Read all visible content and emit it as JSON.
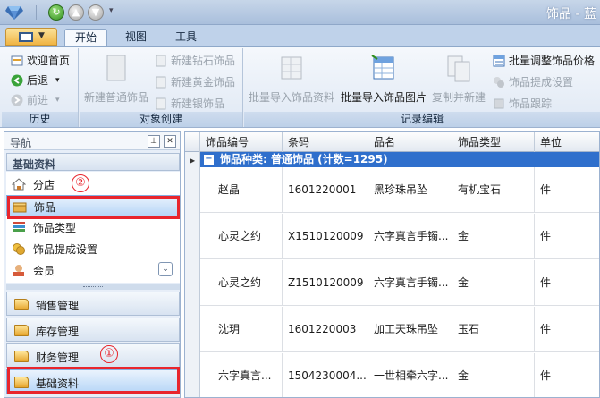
{
  "window": {
    "title": "饰品 - 蓝"
  },
  "ribbon_tabs": [
    {
      "label": "开始",
      "active": true
    },
    {
      "label": "视图",
      "active": false
    },
    {
      "label": "工具",
      "active": false
    }
  ],
  "groups": {
    "history": {
      "label": "历史",
      "home": "欢迎首页",
      "back": "后退",
      "forward": "前进"
    },
    "create": {
      "label": "对象创建",
      "new_normal": "新建普通饰品",
      "new_diamond": "新建钻石饰品",
      "new_gold": "新建黄金饰品",
      "new_silver": "新建银饰品"
    },
    "edit": {
      "label": "记录编辑",
      "batch_import_data": "批量导入饰品资料",
      "batch_import_images": "批量导入饰品图片",
      "copy_new": "复制并新建",
      "batch_adjust_price": "批量调整饰品价格",
      "commission": "饰品提成设置",
      "trace": "饰品跟踪"
    }
  },
  "nav": {
    "title": "导航",
    "section": "基础资料",
    "items": [
      "分店",
      "饰品",
      "饰品类型",
      "饰品提成设置",
      "会员"
    ],
    "modules": [
      "销售管理",
      "库存管理",
      "财务管理",
      "基础资料"
    ]
  },
  "annotations": {
    "one": "①",
    "two": "②"
  },
  "grid": {
    "columns": [
      "饰品编号",
      "条码",
      "品名",
      "饰品类型",
      "单位"
    ],
    "group_label": "饰品种类: 普通饰品 (计数=1295)",
    "rows": [
      [
        "赵晶",
        "1601220001",
        "黑珍珠吊坠",
        "有机宝石",
        "件"
      ],
      [
        "心灵之约",
        "X1510120009",
        "六字真言手镯...",
        "金",
        "件"
      ],
      [
        "心灵之约",
        "Z1510120009",
        "六字真言手镯...",
        "金",
        "件"
      ],
      [
        "沈玥",
        "1601220003",
        "加工天珠吊坠",
        "玉石",
        "件"
      ],
      [
        "六字真言...",
        "1504230004...",
        "一世相牵六字...",
        "金",
        "件"
      ]
    ]
  },
  "colors": {
    "highlight": "#e8252d",
    "group_row": "#2f6fcc",
    "selection": "#b7d6f7"
  }
}
